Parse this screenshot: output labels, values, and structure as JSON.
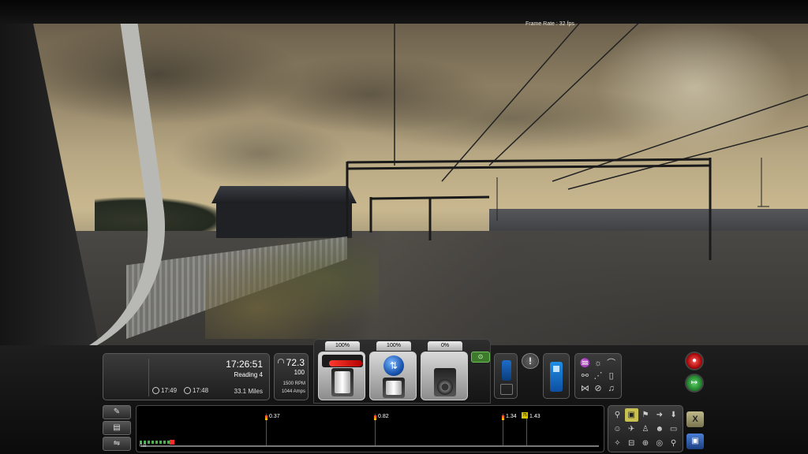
{
  "overlay": {
    "frame_rate": "Frame Rate : 32 fps"
  },
  "hud": {
    "time": "17:26:51",
    "destination": "Reading 4",
    "eta_1": "17:49",
    "eta_2": "17:48",
    "distance": "33.1 Miles",
    "speed": "72.3",
    "speed_limit": "100",
    "rpm": "1500 RPM",
    "amps": "1044 Amps"
  },
  "controls": {
    "throttle_pct": "100%",
    "reverser_pct": "100%",
    "brake_pct": "0%",
    "throttle_level": 1.0,
    "brake_level": 0.0
  },
  "track_monitor": {
    "start": "0.0",
    "markers": [
      "0.37",
      "0.82",
      "1.34",
      "1.43"
    ],
    "marker_badge": "75"
  },
  "icons": {
    "camera": "camera-icon",
    "alert": "alert-icon",
    "fuel": "fuel-pump-icon",
    "close": "close-icon"
  },
  "symbols": {
    "cam": "⊙",
    "alert": "!",
    "red_btn": "●",
    "green_btn": "↦",
    "close": "X",
    "cam2": "▣"
  }
}
